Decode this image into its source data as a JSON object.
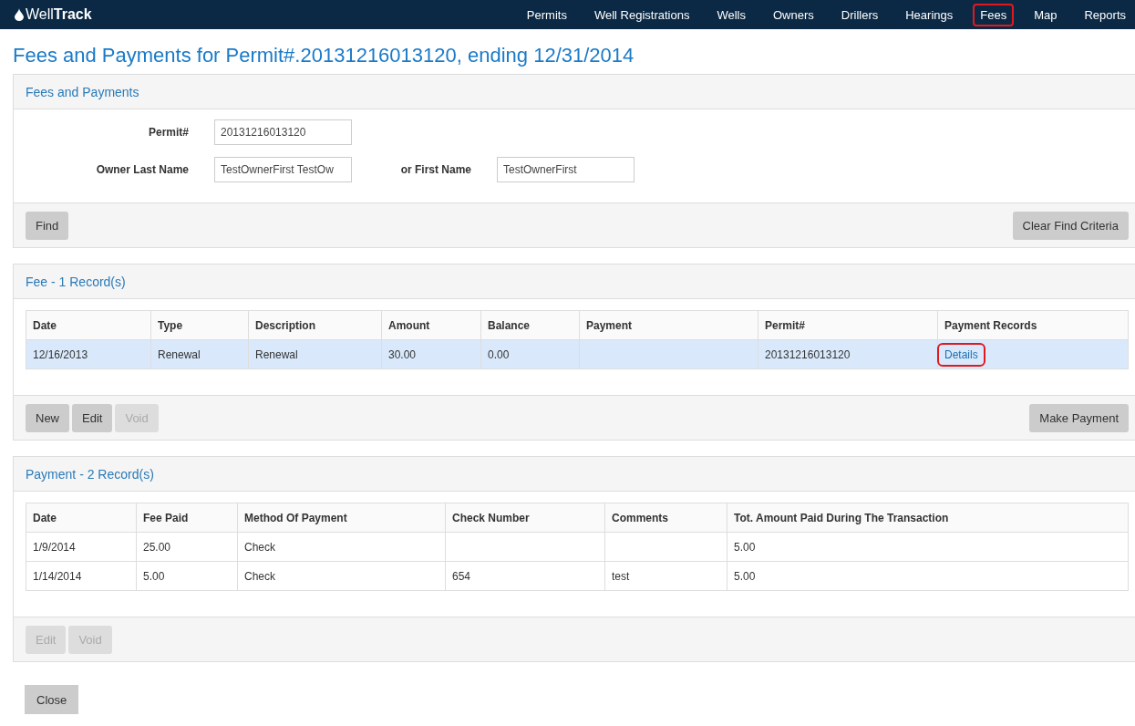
{
  "header": {
    "logo": "Well**Track**",
    "nav": [
      {
        "label": "Permits",
        "highlighted": false
      },
      {
        "label": "Well Registrations",
        "highlighted": false
      },
      {
        "label": "Wells",
        "highlighted": false
      },
      {
        "label": "Owners",
        "highlighted": false
      },
      {
        "label": "Drillers",
        "highlighted": false
      },
      {
        "label": "Hearings",
        "highlighted": false
      },
      {
        "label": "Fees",
        "highlighted": true
      },
      {
        "label": "Map",
        "highlighted": false
      },
      {
        "label": "Reports",
        "highlighted": false
      }
    ]
  },
  "page_title": "Fees and Payments for Permit#.20131216013120, ending 12/31/2014",
  "search_panel": {
    "title": "Fees and Payments",
    "fields": [
      {
        "label": "Permit#",
        "value": "20131216013120"
      },
      {
        "label": "Owner Last Name",
        "value": "TestOwnerFirst TestOw"
      },
      {
        "label": "or First Name",
        "value": "TestOwnerFirst"
      }
    ],
    "buttons_left": [
      {
        "label": "Find",
        "disabled": false
      }
    ],
    "buttons_right": [
      {
        "label": "Clear Find Criteria",
        "disabled": false
      }
    ]
  },
  "fee_panel": {
    "title": "Fee - 1 Record(s)",
    "table": {
      "columns": [
        "Date",
        "Type",
        "Description",
        "Amount",
        "Balance",
        "Payment",
        "Permit#",
        "Payment Records"
      ],
      "rows": [
        {
          "selected": true,
          "cells": [
            {
              "text": "12/16/2013"
            },
            {
              "text": "Renewal"
            },
            {
              "text": "Renewal"
            },
            {
              "text": "30.00"
            },
            {
              "text": "0.00"
            },
            {
              "text": ""
            },
            {
              "text": "20131216013120"
            },
            {
              "text": "Details",
              "kind": "link",
              "highlighted": true
            }
          ]
        }
      ]
    },
    "buttons_left": [
      {
        "label": "New",
        "disabled": false
      },
      {
        "label": "Edit",
        "disabled": false
      },
      {
        "label": "Void",
        "disabled": true
      }
    ],
    "buttons_right": [
      {
        "label": "Make Payment",
        "disabled": false
      }
    ]
  },
  "payment_panel": {
    "title": "Payment - 2 Record(s)",
    "table": {
      "columns": [
        "Date",
        "Fee Paid",
        "Method Of Payment",
        "Check Number",
        "Comments",
        "Tot. Amount Paid During The Transaction"
      ],
      "rows": [
        {
          "selected": false,
          "cells": [
            {
              "text": "1/9/2014"
            },
            {
              "text": "25.00"
            },
            {
              "text": "Check"
            },
            {
              "text": ""
            },
            {
              "text": ""
            },
            {
              "text": "5.00"
            }
          ]
        },
        {
          "selected": false,
          "cells": [
            {
              "text": "1/14/2014"
            },
            {
              "text": "5.00"
            },
            {
              "text": "Check"
            },
            {
              "text": "654"
            },
            {
              "text": "test"
            },
            {
              "text": "5.00"
            }
          ]
        }
      ]
    },
    "buttons_left": [
      {
        "label": "Edit",
        "disabled": true
      },
      {
        "label": "Void",
        "disabled": true
      }
    ]
  },
  "close_button": "Close"
}
